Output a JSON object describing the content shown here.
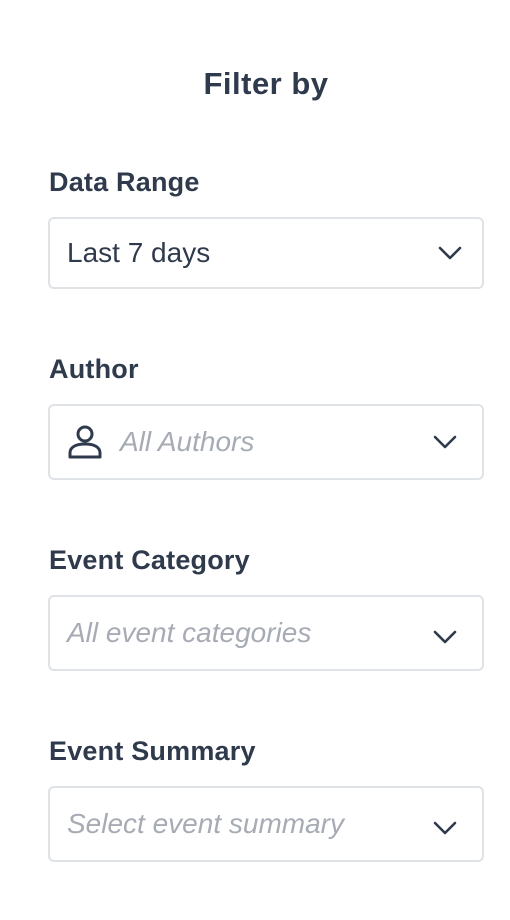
{
  "panel": {
    "title": "Filter by"
  },
  "filters": {
    "date_range": {
      "label": "Data Range",
      "value": "Last 7 days",
      "icon": "chevron-down-icon"
    },
    "author": {
      "label": "Author",
      "placeholder": "All Authors",
      "leading_icon": "person-icon",
      "icon": "chevron-down-icon"
    },
    "event_category": {
      "label": "Event Category",
      "placeholder": "All event categories",
      "icon": "chevron-down-icon"
    },
    "event_summary": {
      "label": "Event Summary",
      "placeholder": "Select event summary",
      "icon": "chevron-down-icon"
    }
  },
  "colors": {
    "text": "#2f3a4d",
    "placeholder": "#a6abb4",
    "border": "#dfe2e7",
    "background": "#ffffff"
  }
}
